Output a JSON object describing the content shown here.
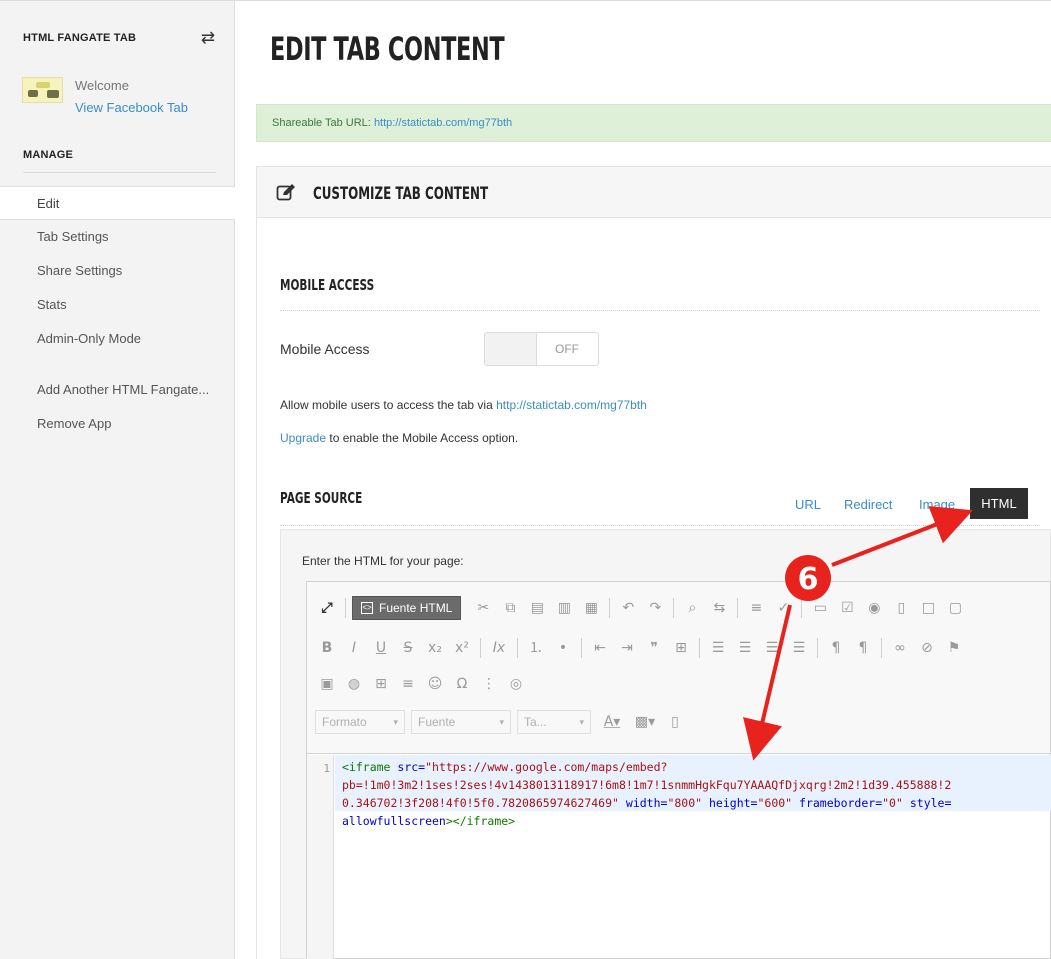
{
  "sidebar": {
    "app_title": "HTML FANGATE TAB",
    "welcome": "Welcome",
    "view_link": "View Facebook Tab",
    "manage_label": "MANAGE",
    "edit": "Edit",
    "items": [
      "Tab Settings",
      "Share Settings",
      "Stats",
      "Admin-Only Mode"
    ],
    "add_another": "Add Another HTML Fangate...",
    "remove_app": "Remove App"
  },
  "main": {
    "title": "EDIT TAB CONTENT",
    "share_label": "Shareable Tab URL:",
    "share_url": "http://statictab.com/mg77bth",
    "panel_title": "CUSTOMIZE TAB CONTENT",
    "mobile": {
      "section_title": "MOBILE ACCESS",
      "label": "Mobile Access",
      "toggle_state": "OFF",
      "desc_prefix": "Allow mobile users to access the tab via",
      "desc_url": "http://statictab.com/mg77bth",
      "upgrade_link": "Upgrade",
      "upgrade_suffix": "to enable the Mobile Access option."
    },
    "page_source": {
      "section_title": "PAGE SOURCE",
      "tabs": [
        "URL",
        "Redirect",
        "Image"
      ],
      "active_tab": "HTML",
      "editor_label": "Enter the HTML for your page:"
    }
  },
  "editor": {
    "source_button": "Fuente HTML",
    "format_combo": "Formato",
    "font_combo": "Fuente",
    "size_combo": "Ta...",
    "line_number": "1",
    "code": {
      "l1_tag_open": "<iframe",
      "l1_attr_src": "src=",
      "l1_src_val": "\"https://www.google.com/maps/embed?",
      "l2": "pb=!1m0!3m2!1ses!2ses!4v1438013118917!6m8!1m7!1snmmHgkFqu7YAAAQfDjxqrg!2m2!1d39.455888!2",
      "l3_val": "0.346702!3f208!4f0!5f0.7820865974627469\"",
      "l3_attr_width": "width=",
      "l3_width_val": "\"800\"",
      "l3_attr_height": "height=",
      "l3_height_val": "\"600\"",
      "l3_attr_frameborder": "frameborder=",
      "l3_frameborder_val": "\"0\"",
      "l3_attr_style": "style=",
      "l4_attr": "allowfullscreen",
      "l4_tag_close": "></iframe>"
    }
  },
  "annotation": {
    "step_number": "6",
    "arrow_color": "#e8231e"
  },
  "colors": {
    "link": "#3a8dc9",
    "success_bg": "#dff0d8",
    "success_text": "#3c763d",
    "active_tab_bg": "#2f2f2f"
  }
}
